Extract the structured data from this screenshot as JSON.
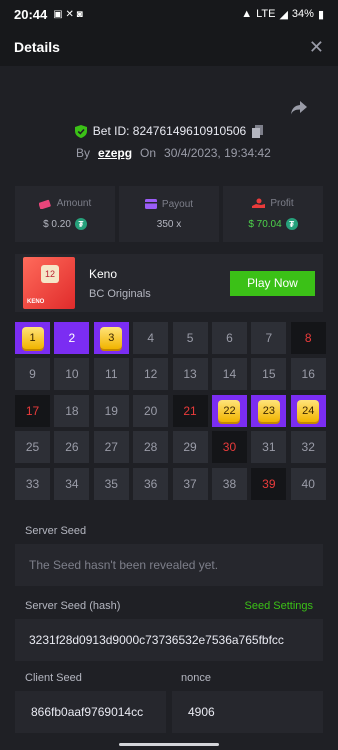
{
  "status": {
    "time": "20:44",
    "network": "LTE",
    "battery": "34%"
  },
  "header": {
    "title": "Details"
  },
  "bet": {
    "id_text": "Bet ID: 82476149610910506",
    "by_label": "By",
    "user": "ezepg",
    "on_label": "On",
    "datetime": "30/4/2023, 19:34:42"
  },
  "stats": {
    "amount": {
      "label": "Amount",
      "value": "$ 0.20"
    },
    "payout": {
      "label": "Payout",
      "value": "350 x"
    },
    "profit": {
      "label": "Profit",
      "value": "$ 70.04"
    }
  },
  "game": {
    "name": "Keno",
    "provider": "BC Originals",
    "play_label": "Play Now",
    "thumb_label": "KENO",
    "thumb_tile": "12"
  },
  "keno": {
    "cells": [
      {
        "n": "1",
        "state": "hit"
      },
      {
        "n": "2",
        "state": "pick"
      },
      {
        "n": "3",
        "state": "hit"
      },
      {
        "n": "4",
        "state": ""
      },
      {
        "n": "5",
        "state": ""
      },
      {
        "n": "6",
        "state": ""
      },
      {
        "n": "7",
        "state": ""
      },
      {
        "n": "8",
        "state": "sel"
      },
      {
        "n": "9",
        "state": ""
      },
      {
        "n": "10",
        "state": ""
      },
      {
        "n": "11",
        "state": ""
      },
      {
        "n": "12",
        "state": ""
      },
      {
        "n": "13",
        "state": ""
      },
      {
        "n": "14",
        "state": ""
      },
      {
        "n": "15",
        "state": ""
      },
      {
        "n": "16",
        "state": ""
      },
      {
        "n": "17",
        "state": "sel"
      },
      {
        "n": "18",
        "state": ""
      },
      {
        "n": "19",
        "state": ""
      },
      {
        "n": "20",
        "state": ""
      },
      {
        "n": "21",
        "state": "sel"
      },
      {
        "n": "22",
        "state": "hit"
      },
      {
        "n": "23",
        "state": "hit"
      },
      {
        "n": "24",
        "state": "hit"
      },
      {
        "n": "25",
        "state": ""
      },
      {
        "n": "26",
        "state": ""
      },
      {
        "n": "27",
        "state": ""
      },
      {
        "n": "28",
        "state": ""
      },
      {
        "n": "29",
        "state": ""
      },
      {
        "n": "30",
        "state": "sel"
      },
      {
        "n": "31",
        "state": ""
      },
      {
        "n": "32",
        "state": ""
      },
      {
        "n": "33",
        "state": ""
      },
      {
        "n": "34",
        "state": ""
      },
      {
        "n": "35",
        "state": ""
      },
      {
        "n": "36",
        "state": ""
      },
      {
        "n": "37",
        "state": ""
      },
      {
        "n": "38",
        "state": ""
      },
      {
        "n": "39",
        "state": "sel"
      },
      {
        "n": "40",
        "state": ""
      }
    ]
  },
  "seeds": {
    "server_label": "Server Seed",
    "server_value": "The Seed hasn't been revealed yet.",
    "hash_label": "Server Seed (hash)",
    "settings_label": "Seed Settings",
    "hash_value": "3231f28d0913d9000c73736532e7536a765fbfcc",
    "client_label": "Client Seed",
    "client_value": "866fb0aaf9769014cc",
    "nonce_label": "nonce",
    "nonce_value": "4906"
  },
  "colors": {
    "accent_green": "#3bc117",
    "keno_purple": "#7b2df2",
    "miss_red": "#ea3b3b"
  }
}
